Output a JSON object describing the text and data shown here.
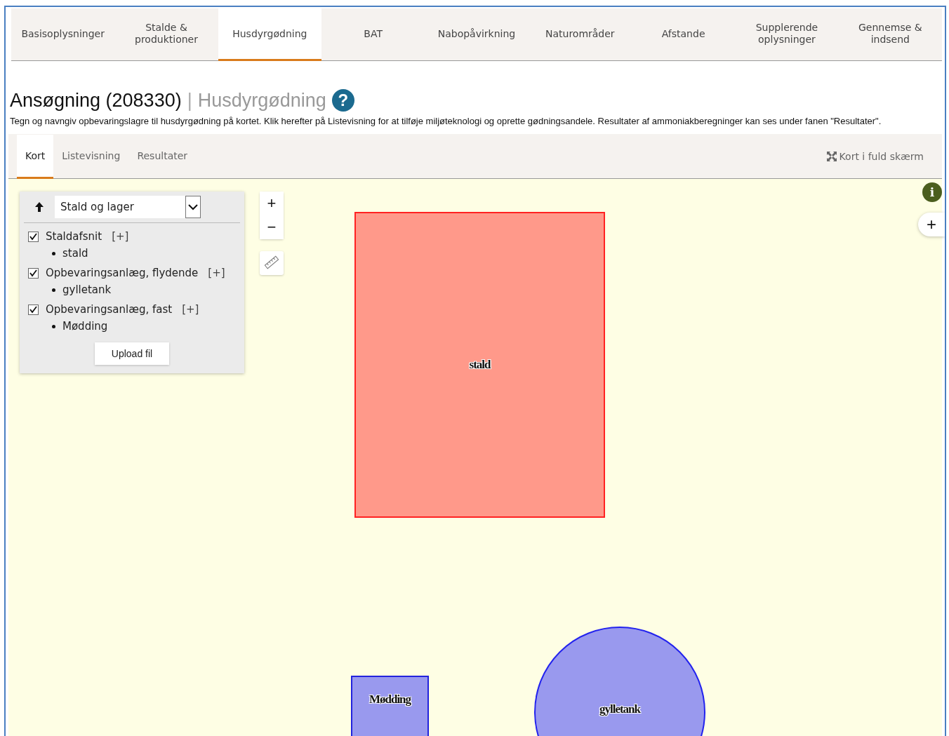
{
  "main_tabs": [
    {
      "label": "Basisoplysninger",
      "selected": false
    },
    {
      "label": "Stalde & produktioner",
      "selected": false
    },
    {
      "label": "Husdyrgødning",
      "selected": true
    },
    {
      "label": "BAT",
      "selected": false
    },
    {
      "label": "Nabopåvirkning",
      "selected": false
    },
    {
      "label": "Naturområder",
      "selected": false
    },
    {
      "label": "Afstande",
      "selected": false
    },
    {
      "label": "Supplerende oplysninger",
      "selected": false
    },
    {
      "label": "Gennemse & indsend",
      "selected": false
    }
  ],
  "heading": {
    "title": "Ansøgning (208330)",
    "separator": "|",
    "subtitle": "Husdyrgødning",
    "help": "?"
  },
  "description": "Tegn og navngiv opbevaringslagre til husdyrgødning på kortet. Klik herefter på Listevisning for at tilføje miljøteknologi og oprette gødningsandele. Resultater af ammoniakberegninger kan ses under fanen \"Resultater\".",
  "sub_tabs": [
    {
      "label": "Kort",
      "selected": true
    },
    {
      "label": "Listevisning",
      "selected": false
    },
    {
      "label": "Resultater",
      "selected": false
    }
  ],
  "fullscreen_link": "Kort i fuld skærm",
  "layer_panel": {
    "select_value": "Stald og lager",
    "upload_button": "Upload fil",
    "groups": [
      {
        "label": "Staldafsnit",
        "add": "[+]",
        "checked": true,
        "items": [
          "stald"
        ]
      },
      {
        "label": "Opbevaringsanlæg, flydende",
        "add": "[+]",
        "checked": true,
        "items": [
          "gylletank"
        ]
      },
      {
        "label": "Opbevaringsanlæg, fast",
        "add": "[+]",
        "checked": true,
        "items": [
          "Mødding"
        ]
      }
    ]
  },
  "zoom_controls": {
    "zoom_in": "+",
    "zoom_out": "−"
  },
  "side_control": "+",
  "info_button": "i",
  "map_features": [
    {
      "kind": "rect",
      "label": "stald",
      "color": "#ff998a"
    },
    {
      "kind": "square",
      "label": "Mødding",
      "color": "#9999ee"
    },
    {
      "kind": "circle",
      "label": "gylletank",
      "color": "#9999ee"
    }
  ]
}
